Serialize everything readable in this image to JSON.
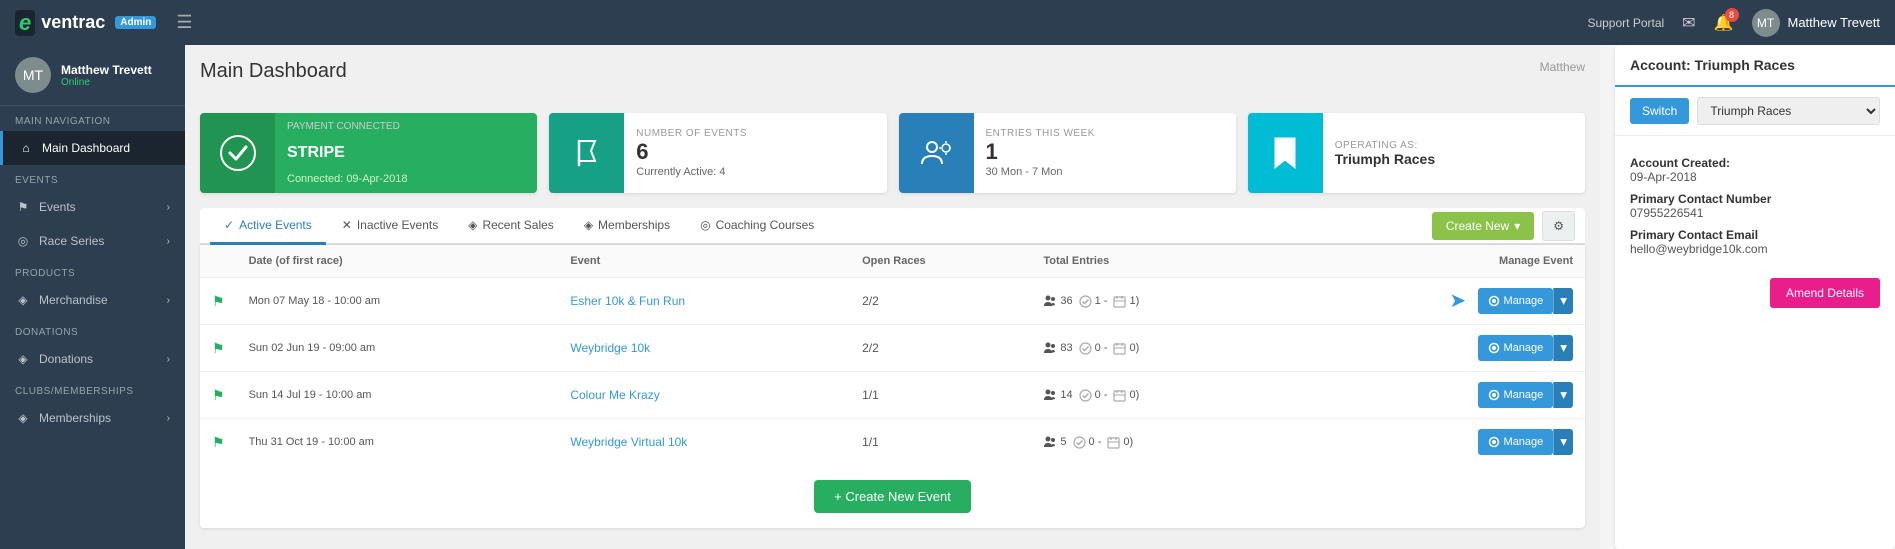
{
  "topbar": {
    "logo": "eventrac",
    "admin_badge": "Admin",
    "support_link": "Support Portal",
    "user_name": "Matthew Trevett",
    "notifications_count": "8",
    "page_title_right": "Matthew"
  },
  "sidebar": {
    "username": "Matthew Trevett",
    "status": "Online",
    "sections": [
      {
        "label": "MAIN NAVIGATION",
        "items": [
          {
            "icon": "⌂",
            "text": "Main Dashboard",
            "active": true
          }
        ]
      },
      {
        "label": "Events",
        "items": [
          {
            "icon": "⚑",
            "text": "Events",
            "has_arrow": true
          },
          {
            "icon": "◎",
            "text": "Race Series",
            "has_arrow": true
          }
        ]
      },
      {
        "label": "Products",
        "items": [
          {
            "icon": "◈",
            "text": "Merchandise",
            "has_arrow": true
          }
        ]
      },
      {
        "label": "Donations",
        "items": [
          {
            "icon": "◈",
            "text": "Donations",
            "has_arrow": true
          }
        ]
      },
      {
        "label": "Clubs/Memberships",
        "items": [
          {
            "icon": "◈",
            "text": "Memberships",
            "has_arrow": true
          }
        ]
      }
    ]
  },
  "page_title": "Main Dashboard",
  "stats": [
    {
      "type": "payment",
      "label": "PAYMENT CONNECTED",
      "value": "STRIPE",
      "sub": "Connected: 09-Apr-2018"
    },
    {
      "type": "events",
      "label": "NUMBER OF EVENTS",
      "value": "6",
      "sub": "Currently Active: 4"
    },
    {
      "type": "entries",
      "label": "ENTRIES THIS WEEK",
      "value": "1",
      "sub": "30 Mon - 7 Mon"
    },
    {
      "type": "operating",
      "label": "OPERATING AS:",
      "value": "Triumph Races"
    }
  ],
  "tabs": [
    {
      "id": "active",
      "icon": "✓",
      "label": "Active Events",
      "active": true
    },
    {
      "id": "inactive",
      "icon": "✕",
      "label": "Inactive Events"
    },
    {
      "id": "sales",
      "icon": "◈",
      "label": "Recent Sales"
    },
    {
      "id": "memberships",
      "icon": "◈",
      "label": "Memberships"
    },
    {
      "id": "coaching",
      "icon": "◎",
      "label": "Coaching Courses"
    }
  ],
  "toolbar": {
    "create_new_label": "Create New",
    "settings_icon": "⚙"
  },
  "table": {
    "headers": [
      "Date (of first race)",
      "Event",
      "Open Races",
      "Total Entries",
      "Manage Event"
    ],
    "rows": [
      {
        "date": "Mon 07 May 18 - 10:00 am",
        "event": "Esher 10k & Fun Run",
        "open_races": "2/2",
        "entries_people": "36",
        "entries_check": "1",
        "entries_cal": "1",
        "arrow": true
      },
      {
        "date": "Sun 02 Jun 19 - 09:00 am",
        "event": "Weybridge 10k",
        "open_races": "2/2",
        "entries_people": "83",
        "entries_check": "0",
        "entries_cal": "0",
        "arrow": false
      },
      {
        "date": "Sun 14 Jul 19 - 10:00 am",
        "event": "Colour Me Krazy",
        "open_races": "1/1",
        "entries_people": "14",
        "entries_check": "0",
        "entries_cal": "0",
        "arrow": false
      },
      {
        "date": "Thu 31 Oct 19 - 10:00 am",
        "event": "Weybridge Virtual 10k",
        "open_races": "1/1",
        "entries_people": "5",
        "entries_check": "0",
        "entries_cal": "0",
        "arrow": false
      }
    ],
    "create_event_label": "+ Create New Event"
  },
  "right_panel": {
    "title": "Account: Triumph Races",
    "switch_label": "Switch",
    "account_name": "Triumph Races",
    "account_created_label": "Account Created:",
    "account_created_value": "09-Apr-2018",
    "contact_label": "Primary Contact Number",
    "contact_value": "07955226541",
    "email_label": "Primary Contact Email",
    "email_value": "hello@weybridge10k.com",
    "amend_label": "Amend Details"
  }
}
